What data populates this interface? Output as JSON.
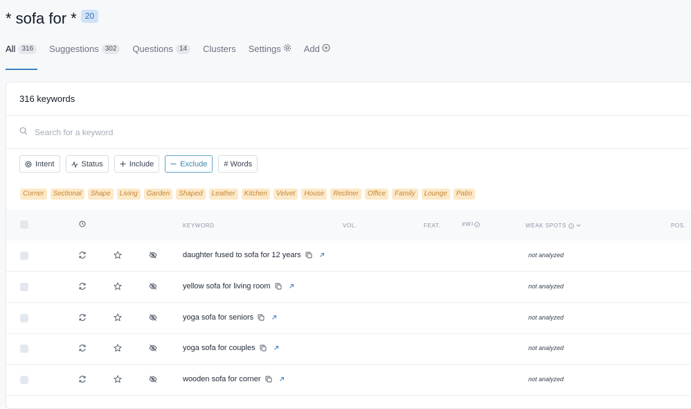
{
  "header": {
    "title": "* sofa for *",
    "badge": "20"
  },
  "tabs": [
    {
      "label": "All",
      "count": "316"
    },
    {
      "label": "Suggestions",
      "count": "302"
    },
    {
      "label": "Questions",
      "count": "14"
    },
    {
      "label": "Clusters"
    },
    {
      "label": "Settings"
    },
    {
      "label": "Add"
    }
  ],
  "summary": {
    "keyword_count": "316 keywords"
  },
  "search": {
    "placeholder": "Search for a keyword"
  },
  "filters": {
    "intent": "Intent",
    "status": "Status",
    "include": "Include",
    "exclude": "Exclude",
    "words": "# Words"
  },
  "tags": [
    "Corner",
    "Sectional",
    "Shape",
    "Living",
    "Garden",
    "Shaped",
    "Leather",
    "Kitchen",
    "Velvet",
    "House",
    "Recliner",
    "Office",
    "Family",
    "Lounge",
    "Patio"
  ],
  "table": {
    "columns": {
      "keyword": "KEYWORD",
      "vol": "VOL.",
      "feat": "FEAT.",
      "words": "#W",
      "words_sup": "3",
      "weak_spots": "WEAK SPOTS",
      "pos": "POS."
    },
    "rows": [
      {
        "keyword": "daughter fused to sofa for 12 years",
        "weak_spots": "not analyzed"
      },
      {
        "keyword": "yellow sofa for living room",
        "weak_spots": "not analyzed"
      },
      {
        "keyword": "yoga sofa for seniors",
        "weak_spots": "not analyzed"
      },
      {
        "keyword": "yoga sofa for couples",
        "weak_spots": "not analyzed"
      },
      {
        "keyword": "wooden sofa for corner",
        "weak_spots": "not analyzed"
      }
    ]
  },
  "colors": {
    "accent": "#3b82c4",
    "tag_bg": "#fde9c8",
    "tag_text": "#c48536"
  }
}
